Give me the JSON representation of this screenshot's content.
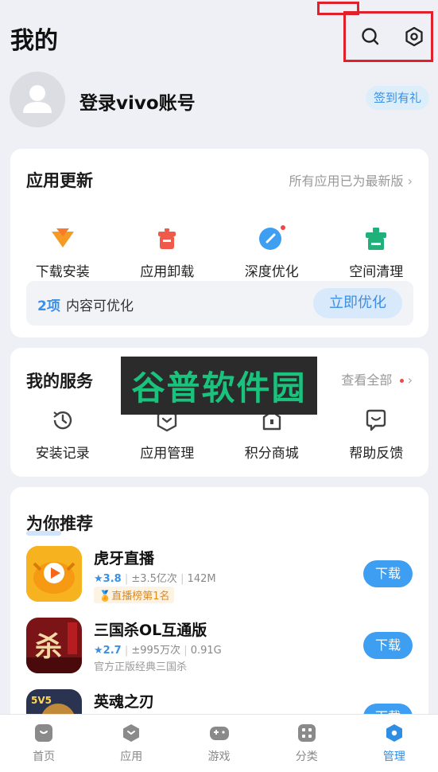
{
  "header": {
    "title": "我的"
  },
  "profile": {
    "login_text": "登录vivo账号",
    "sign_badge": "签到有礼"
  },
  "app_update": {
    "title": "应用更新",
    "status_link": "所有应用已为最新版",
    "actions": [
      {
        "label": "下载安装",
        "icon": "download-install-icon"
      },
      {
        "label": "应用卸载",
        "icon": "uninstall-icon"
      },
      {
        "label": "深度优化",
        "icon": "deep-optimize-icon"
      },
      {
        "label": "空间清理",
        "icon": "space-clean-icon"
      }
    ],
    "optimize_count": "2项",
    "optimize_text": "内容可优化",
    "optimize_button": "立即优化"
  },
  "my_services": {
    "title": "我的服务",
    "view_all": "查看全部",
    "items": [
      {
        "label": "安装记录",
        "icon": "history-icon"
      },
      {
        "label": "应用管理",
        "icon": "app-manage-icon"
      },
      {
        "label": "积分商城",
        "icon": "points-mall-icon"
      },
      {
        "label": "帮助反馈",
        "icon": "feedback-icon"
      }
    ]
  },
  "watermark": "谷普软件园",
  "recommend": {
    "title": "为你推荐",
    "apps": [
      {
        "name": "虎牙直播",
        "rating": "3.8",
        "downloads": "±3.5亿次",
        "size": "142M",
        "tag": "直播榜第1名",
        "button": "下载",
        "icon_color": "#f7b21f"
      },
      {
        "name": "三国杀OL互通版",
        "rating": "2.7",
        "downloads": "±995万次",
        "size": "0.91G",
        "tag": "官方正版经典三国杀",
        "button": "下载",
        "icon_color": "#7a1416"
      },
      {
        "name": "英魂之刃",
        "rating": "",
        "downloads": "",
        "size": "",
        "tag": "",
        "button": "下载",
        "icon_color": "#2a3350"
      }
    ]
  },
  "tabbar": {
    "tabs": [
      {
        "label": "首页",
        "icon": "home-icon"
      },
      {
        "label": "应用",
        "icon": "apps-icon"
      },
      {
        "label": "游戏",
        "icon": "gamepad-icon"
      },
      {
        "label": "分类",
        "icon": "category-icon"
      },
      {
        "label": "管理",
        "icon": "manage-icon"
      }
    ]
  },
  "colors": {
    "accent": "#3b8fe6",
    "highlight_box": "#e0202a"
  }
}
